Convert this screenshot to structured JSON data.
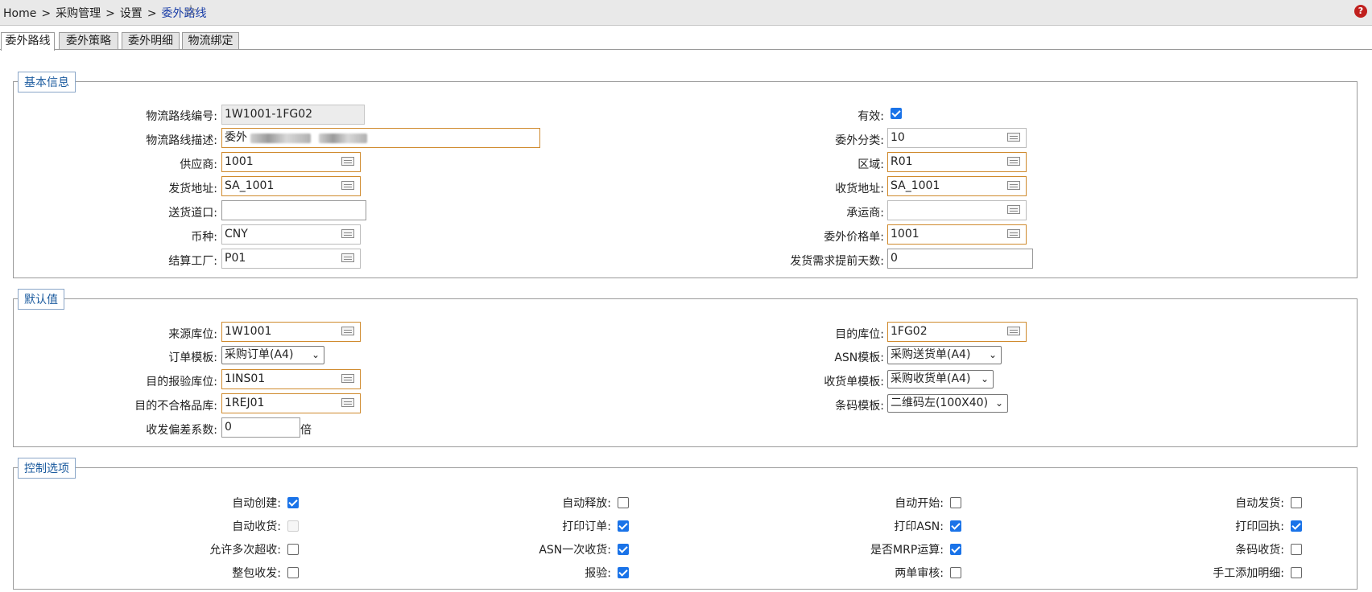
{
  "breadcrumb": {
    "items": [
      "Home",
      "采购管理",
      "设置"
    ],
    "current": "委外路线",
    "separator": ">"
  },
  "help_label": "?",
  "tabs": [
    "委外路线",
    "委外策略",
    "委外明细",
    "物流绑定"
  ],
  "basic": {
    "legend": "基本信息",
    "route_no_label": "物流路线编号:",
    "route_no": "1W1001-1FG02",
    "route_desc_label": "物流路线描述:",
    "route_desc": "委外",
    "supplier_label": "供应商:",
    "supplier": "1001",
    "ship_addr_label": "发货地址:",
    "ship_addr": "SA_1001",
    "dock_label": "送货道口:",
    "dock": "",
    "currency_label": "币种:",
    "currency": "CNY",
    "plant_label": "结算工厂:",
    "plant": "P01",
    "valid_label": "有效:",
    "category_label": "委外分类:",
    "category": "10",
    "region_label": "区域:",
    "region": "R01",
    "recv_addr_label": "收货地址:",
    "recv_addr": "SA_1001",
    "carrier_label": "承运商:",
    "carrier": "",
    "price_list_label": "委外价格单:",
    "price_list": "1001",
    "lead_days_label": "发货需求提前天数:",
    "lead_days": "0"
  },
  "defaults": {
    "legend": "默认值",
    "src_loc_label": "来源库位:",
    "src_loc": "1W1001",
    "order_tpl_label": "订单模板:",
    "order_tpl": "采购订单(A4)",
    "insp_loc_label": "目的报验库位:",
    "insp_loc": "1INS01",
    "rej_loc_label": "目的不合格品库:",
    "rej_loc": "1REJ01",
    "dev_label": "收发偏差系数:",
    "dev": "0",
    "dev_unit": "倍",
    "dest_loc_label": "目的库位:",
    "dest_loc": "1FG02",
    "asn_tpl_label": "ASN模板:",
    "asn_tpl": "采购送货单(A4)",
    "recv_tpl_label": "收货单模板:",
    "recv_tpl": "采购收货单(A4)",
    "barcode_tpl_label": "条码模板:",
    "barcode_tpl": "二维码左(100X40)"
  },
  "control": {
    "legend": "控制选项",
    "options": [
      {
        "label": "自动创建:",
        "checked": true,
        "disabled": false
      },
      {
        "label": "自动释放:",
        "checked": false,
        "disabled": false
      },
      {
        "label": "自动开始:",
        "checked": false,
        "disabled": false
      },
      {
        "label": "自动发货:",
        "checked": false,
        "disabled": false
      },
      {
        "label": "自动收货:",
        "checked": false,
        "disabled": true
      },
      {
        "label": "打印订单:",
        "checked": true,
        "disabled": false
      },
      {
        "label": "打印ASN:",
        "checked": true,
        "disabled": false
      },
      {
        "label": "打印回执:",
        "checked": true,
        "disabled": false
      },
      {
        "label": "允许多次超收:",
        "checked": false,
        "disabled": false
      },
      {
        "label": "ASN一次收货:",
        "checked": true,
        "disabled": false
      },
      {
        "label": "是否MRP运算:",
        "checked": true,
        "disabled": false
      },
      {
        "label": "条码收货:",
        "checked": false,
        "disabled": false
      },
      {
        "label": "整包收发:",
        "checked": false,
        "disabled": false
      },
      {
        "label": "报验:",
        "checked": true,
        "disabled": false
      },
      {
        "label": "两单审核:",
        "checked": false,
        "disabled": false
      },
      {
        "label": "手工添加明细:",
        "checked": false,
        "disabled": false
      }
    ]
  }
}
